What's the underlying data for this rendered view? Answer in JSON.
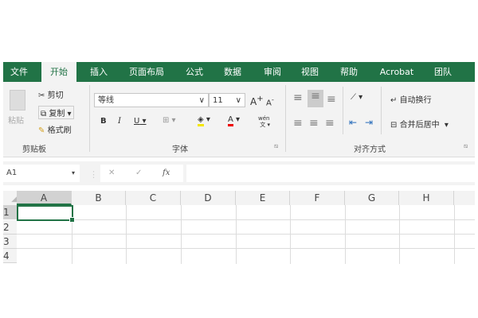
{
  "tabs": [
    "文件",
    "开始",
    "插入",
    "页面布局",
    "公式",
    "数据",
    "审阅",
    "视图",
    "帮助",
    "Acrobat",
    "团队"
  ],
  "clipboard": {
    "paste": "粘贴",
    "cut": "剪切",
    "copy": "复制",
    "format_painter": "格式刷",
    "group": "剪贴板"
  },
  "font": {
    "name": "等线",
    "size": "11",
    "bold": "B",
    "italic": "I",
    "underline": "U",
    "grow": "A",
    "shrink": "A",
    "font_color": "A",
    "phonetic": "wén",
    "group": "字体"
  },
  "alignment": {
    "wrap": "自动换行",
    "merge": "合并后居中",
    "group": "对齐方式"
  },
  "formula_bar": {
    "name_box": "A1",
    "cancel": "✕",
    "enter": "✓",
    "fx": "fx",
    "value": ""
  },
  "columns": [
    "A",
    "B",
    "C",
    "D",
    "E",
    "F",
    "G",
    "H"
  ],
  "rows": [
    "1",
    "2",
    "3",
    "4"
  ],
  "colors": {
    "accent": "#217346"
  }
}
